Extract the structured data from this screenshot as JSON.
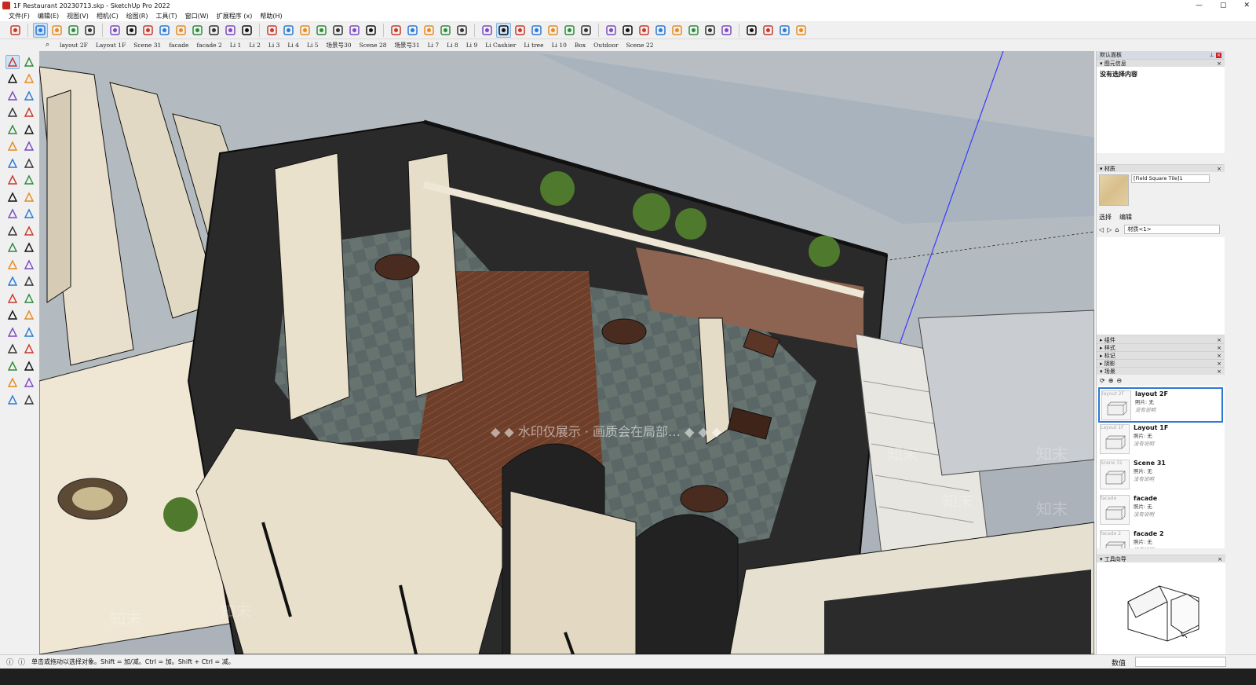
{
  "window": {
    "title": "1F Restaurant 20230713.skp - SketchUp Pro 2022",
    "minimize": "—",
    "maximize": "▢",
    "close": "✕"
  },
  "menu": [
    "文件(F)",
    "编辑(E)",
    "视图(V)",
    "相机(C)",
    "绘图(R)",
    "工具(T)",
    "窗口(W)",
    "扩展程序 (x)",
    "帮助(H)"
  ],
  "toolbar_icons": [
    "search-icon",
    "select-icon",
    "eraser-icon",
    "pencil-icon",
    "arc-icon",
    "paint-icon",
    "push-pull-icon",
    "follow-me-icon",
    "move-icon",
    "rotate-icon",
    "scale-icon",
    "tape-icon",
    "text-icon",
    "paint-bucket-icon",
    "orbit-icon",
    "pan-icon",
    "zoom-icon",
    "zoom-extents-icon",
    "xray-icon",
    "back-edges-icon",
    "wireframe-icon",
    "hidden-line-icon",
    "user-icon",
    "section-plane-icon",
    "section-display-icon",
    "section-cut-icon",
    "section-fill-icon",
    "iso-view-icon",
    "top-view-icon",
    "front-view-icon",
    "right-view-icon",
    "back-view-icon",
    "left-view-icon",
    "extension-1-icon",
    "extension-2-icon",
    "extension-3-icon",
    "add-location-icon",
    "terrain-icon",
    "model-info-icon",
    "checker-icon",
    "cloud-icon",
    "settings-icon",
    "mail-icon",
    "info-icon",
    "account-icon"
  ],
  "scene_tabs": [
    "layout 2F",
    "Layout 1F",
    "Scene 31",
    "facade",
    "facade 2",
    "Li 1",
    "Li 2",
    "Li 3",
    "Li 4",
    "Li 5",
    "场景号30",
    "Scene 28",
    "场景号31",
    "Li 7",
    "Li 8",
    "Li 9",
    "Li Cashier",
    "Li tree",
    "Li 10",
    "Box",
    "Outdoor",
    "Scene 22"
  ],
  "panel": {
    "tray_title": "默认面板",
    "entity_info": {
      "title": "图元信息",
      "text": "没有选择内容"
    },
    "materials": {
      "title": "材质",
      "name": "[Field Square Tile]1",
      "tab_select": "选择",
      "tab_edit": "编辑",
      "dropdown": "材质<1>"
    },
    "collapsed_sections": [
      "组件",
      "样式",
      "标记",
      "阴影"
    ],
    "scenes": {
      "title": "场景",
      "items": [
        {
          "thumb_label": "layout 2F",
          "name": "layout 2F",
          "meta": "照片: 无",
          "desc": "没有说明"
        },
        {
          "thumb_label": "Layout 1F",
          "name": "Layout 1F",
          "meta": "照片: 无",
          "desc": "没有说明"
        },
        {
          "thumb_label": "Scene 31",
          "name": "Scene 31",
          "meta": "照片: 无",
          "desc": "没有说明"
        },
        {
          "thumb_label": "facade",
          "name": "facade",
          "meta": "照片: 无",
          "desc": "没有说明"
        },
        {
          "thumb_label": "facade 2",
          "name": "facade 2",
          "meta": "照片: 无",
          "desc": "没有说明"
        }
      ]
    },
    "instructor": {
      "title": "工具向导"
    }
  },
  "status": {
    "text": "单击或拖动以选择对象。Shift = 加/减。Ctrl = 加。Shift + Ctrl = 减。",
    "vcb_label": "数值",
    "vcb_value": ""
  },
  "watermark": [
    "知末",
    "水印仅展示",
    "画质会在局部…",
    "知末",
    "知末",
    "知末",
    "知末",
    "知末",
    "知末"
  ],
  "colors": {
    "accent": "#2b79d4",
    "sky": "#a9b3bd",
    "wall": "#1c1c1c",
    "floor": "#55605f",
    "wood": "#6d3e2a"
  }
}
